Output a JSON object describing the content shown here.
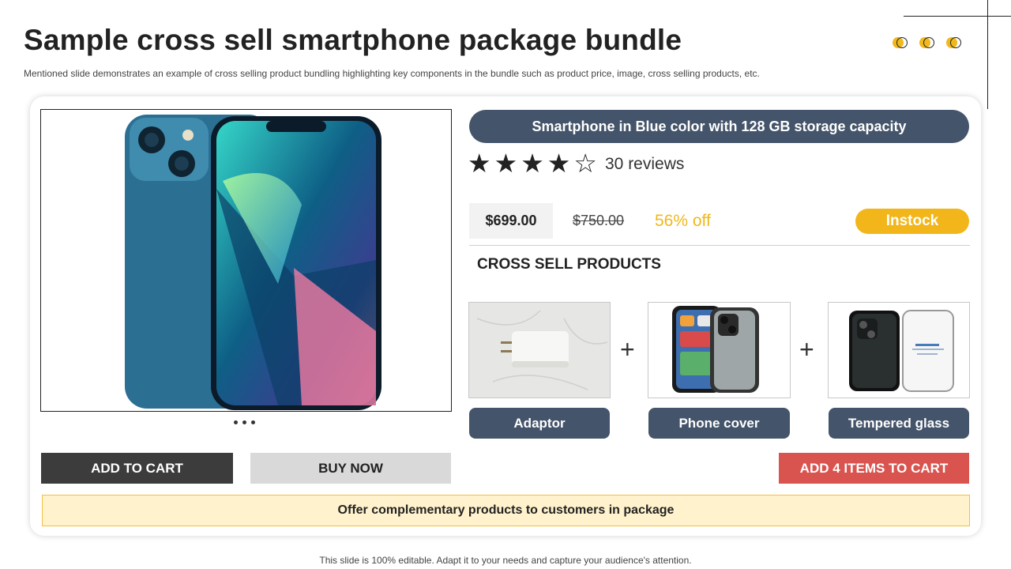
{
  "slide": {
    "title": "Sample cross sell smartphone package bundle",
    "subtitle": "Mentioned slide demonstrates an example of cross selling product bundling highlighting key components in the bundle such as product price, image, cross selling products, etc.",
    "footer": "This slide is 100% editable. Adapt it to your needs and capture your audience's attention."
  },
  "product": {
    "name": "Smartphone in Blue color with 128 GB storage capacity",
    "rating": 4,
    "rating_max": 5,
    "reviews": "30 reviews",
    "price": "$699.00",
    "old_price": "$750.00",
    "discount": "56% off",
    "stock": "Instock",
    "image": "blue-smartphone-image"
  },
  "actions": {
    "add_to_cart": "ADD TO CART",
    "buy_now": "BUY NOW",
    "add_all": "ADD 4 ITEMS TO CART"
  },
  "cross_sell": {
    "heading": "CROSS SELL PRODUCTS",
    "items": [
      {
        "label": "Adaptor",
        "image": "power-adaptor-image"
      },
      {
        "label": "Phone cover",
        "image": "phone-cover-image"
      },
      {
        "label": "Tempered glass",
        "image": "tempered-glass-image"
      }
    ]
  },
  "offer_text": "Offer complementary products to customers in package",
  "colors": {
    "accent_yellow": "#f2b61a",
    "slate": "#44546a",
    "red": "#d9534f",
    "offer_bg": "#fff2cc"
  }
}
